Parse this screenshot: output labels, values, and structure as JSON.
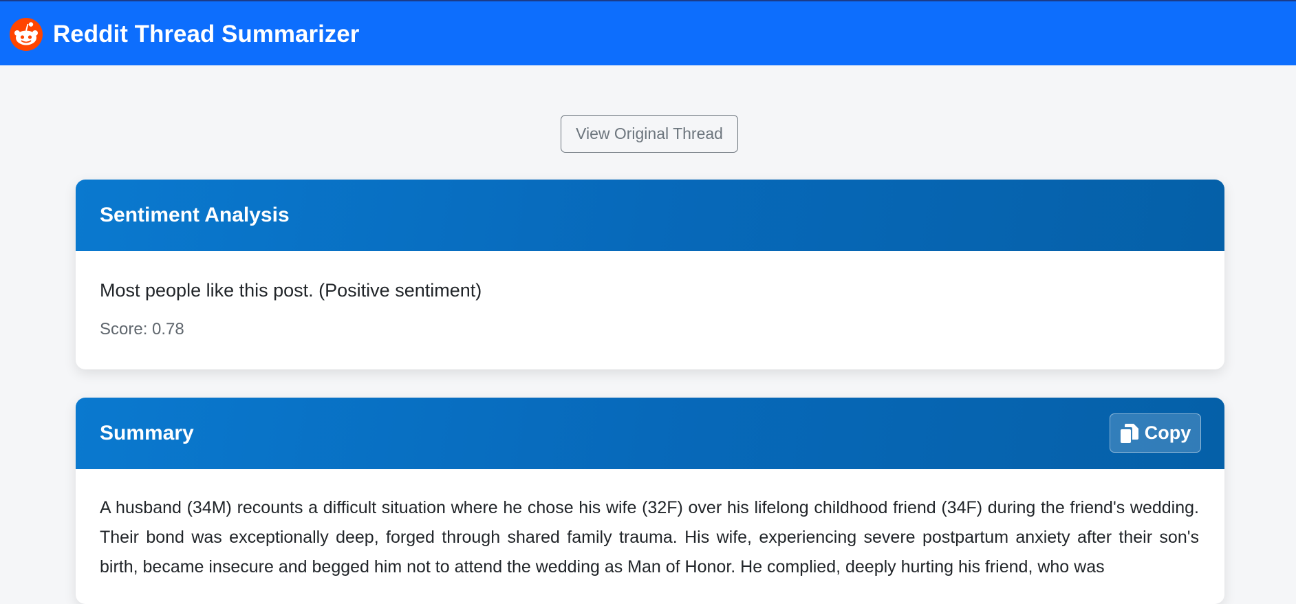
{
  "app": {
    "title": "Reddit Thread Summarizer",
    "logo_icon": "reddit-logo-icon"
  },
  "actions": {
    "view_original_label": "View Original Thread"
  },
  "sentiment": {
    "title": "Sentiment Analysis",
    "description": "Most people like this post. (Positive sentiment)",
    "score_text": "Score: 0.78"
  },
  "summary": {
    "title": "Summary",
    "copy_label": "Copy",
    "copy_icon": "copy-icon",
    "text": "A husband (34M) recounts a difficult situation where he chose his wife (32F) over his lifelong childhood friend (34F) during the friend's wedding. Their bond was exceptionally deep, forged through shared family trauma. His wife, experiencing severe postpartum anxiety after their son's birth, became insecure and begged him not to attend the wedding as Man of Honor. He complied, deeply hurting his friend, who was"
  },
  "colors": {
    "topbar": "#0d6efd",
    "card_header": "#0769ba",
    "page_background": "#f5f6f8",
    "muted_text": "#6c757d"
  }
}
